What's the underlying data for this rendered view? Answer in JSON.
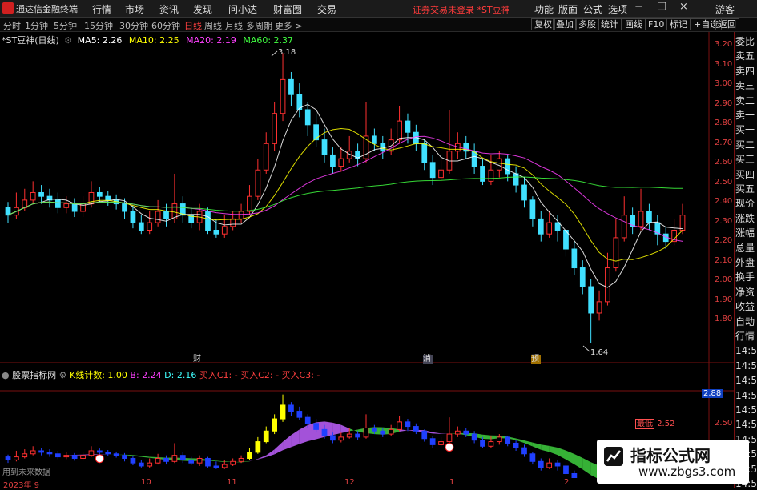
{
  "topbar": {
    "app_name": "通达信金融终端",
    "menus": [
      "行情",
      "市场",
      "资讯",
      "发现",
      "问小达",
      "财富圈",
      "交易"
    ],
    "notice": "证券交易未登录 *ST豆神",
    "right_menus": [
      "功能",
      "版面",
      "公式",
      "选项"
    ],
    "user": "游客"
  },
  "period_bar": {
    "items": [
      "分时",
      "1分钟",
      "5分钟",
      "15分钟",
      "30分钟",
      "60分钟",
      "日线",
      "周线",
      "月线",
      "多周期",
      "更多 >"
    ],
    "active": "日线",
    "tools": [
      "复权",
      "叠加",
      "多股",
      "统计",
      "画线",
      "F10",
      "标记",
      "+自选",
      "返回"
    ]
  },
  "main_legend": {
    "title": "*ST豆神(日线)",
    "ma": [
      {
        "label": "MA5: 2.26",
        "color": "#ffffff"
      },
      {
        "label": "MA10: 2.25",
        "color": "#ffff00"
      },
      {
        "label": "MA20: 2.19",
        "color": "#ff40ff"
      },
      {
        "label": "MA60: 2.37",
        "color": "#40ff40"
      }
    ]
  },
  "ind_legend": {
    "title": "股票指标网",
    "parts": [
      {
        "label": "K线计数: 1.00",
        "color": "#ffff00"
      },
      {
        "label": "B: 2.24",
        "color": "#ff40ff"
      },
      {
        "label": "D: 2.16",
        "color": "#40ffff"
      },
      {
        "label": "买入C1: -",
        "color": "#ff4040"
      },
      {
        "label": "买入C2: -",
        "color": "#ff4040"
      },
      {
        "label": "买入C3: -",
        "color": "#ff4040"
      }
    ]
  },
  "right_panel": [
    "委比",
    "卖五",
    "卖四",
    "卖三",
    "卖二",
    "卖一",
    "买一",
    "买二",
    "买三",
    "买四",
    "买五",
    "现价",
    "涨跌",
    "涨幅",
    "总量",
    "外盘",
    "换手",
    "净资",
    "收益",
    "自动",
    "行情",
    "14:5",
    "14:5",
    "14:5",
    "14:5",
    "14:5",
    "14:5",
    "14:5",
    "14:5",
    "14:5",
    "14:5"
  ],
  "y_axis": [
    "3.20",
    "3.10",
    "3.00",
    "2.90",
    "2.80",
    "2.70",
    "2.60",
    "2.50",
    "2.40",
    "2.30",
    "2.20",
    "2.10",
    "2.00",
    "1.90",
    "1.80"
  ],
  "ind_axis": [
    "2.88",
    "2.50"
  ],
  "x_axis": [
    "2023年 9",
    "10",
    "11",
    "12",
    "1",
    "2"
  ],
  "annotations": {
    "high": "3.18",
    "low": "1.64",
    "ind_tag": "2.52",
    "ind_tag_box": "最低"
  },
  "markers": [
    "财",
    "消",
    "预"
  ],
  "footer_note": "用到未来数据",
  "watermark": {
    "title": "指标公式网",
    "url": "www.zbgs3.com"
  },
  "colors": {
    "up": "#ff3030",
    "down": "#40e0ff",
    "ma5": "#ffffff",
    "ma10": "#ffff00",
    "ma20": "#ff40ff",
    "ma60": "#40ff40"
  },
  "chart_data": {
    "type": "candlestick",
    "ylim": [
      1.6,
      3.25
    ],
    "candles": [
      [
        2.36,
        2.32,
        2.39,
        2.28
      ],
      [
        2.32,
        2.36,
        2.44,
        2.3
      ],
      [
        2.36,
        2.4,
        2.46,
        2.34
      ],
      [
        2.4,
        2.44,
        2.5,
        2.38
      ],
      [
        2.44,
        2.42,
        2.48,
        2.38
      ],
      [
        2.42,
        2.4,
        2.46,
        2.36
      ],
      [
        2.4,
        2.36,
        2.44,
        2.33
      ],
      [
        2.36,
        2.38,
        2.42,
        2.33
      ],
      [
        2.38,
        2.34,
        2.41,
        2.31
      ],
      [
        2.34,
        2.38,
        2.42,
        2.31
      ],
      [
        2.38,
        2.44,
        2.5,
        2.36
      ],
      [
        2.44,
        2.42,
        2.47,
        2.39
      ],
      [
        2.42,
        2.4,
        2.45,
        2.37
      ],
      [
        2.4,
        2.38,
        2.43,
        2.35
      ],
      [
        2.38,
        2.34,
        2.41,
        2.3
      ],
      [
        2.34,
        2.28,
        2.37,
        2.25
      ],
      [
        2.28,
        2.24,
        2.32,
        2.22
      ],
      [
        2.24,
        2.28,
        2.34,
        2.22
      ],
      [
        2.28,
        2.34,
        2.4,
        2.26
      ],
      [
        2.34,
        2.3,
        2.38,
        2.26
      ],
      [
        2.3,
        2.38,
        2.54,
        2.28
      ],
      [
        2.38,
        2.32,
        2.42,
        2.28
      ],
      [
        2.32,
        2.28,
        2.36,
        2.25
      ],
      [
        2.28,
        2.34,
        2.38,
        2.24
      ],
      [
        2.34,
        2.24,
        2.36,
        2.22
      ],
      [
        2.24,
        2.22,
        2.3,
        2.2
      ],
      [
        2.22,
        2.26,
        2.32,
        2.2
      ],
      [
        2.26,
        2.3,
        2.34,
        2.24
      ],
      [
        2.3,
        2.34,
        2.38,
        2.28
      ],
      [
        2.34,
        2.42,
        2.48,
        2.32
      ],
      [
        2.42,
        2.56,
        2.62,
        2.4
      ],
      [
        2.56,
        2.7,
        2.76,
        2.54
      ],
      [
        2.7,
        2.86,
        2.92,
        2.66
      ],
      [
        2.86,
        3.04,
        3.18,
        2.82
      ],
      [
        3.04,
        2.96,
        3.08,
        2.9
      ],
      [
        2.96,
        2.88,
        3.02,
        2.84
      ],
      [
        2.88,
        2.8,
        2.92,
        2.74
      ],
      [
        2.8,
        2.72,
        2.86,
        2.68
      ],
      [
        2.72,
        2.64,
        2.78,
        2.6
      ],
      [
        2.64,
        2.58,
        2.68,
        2.54
      ],
      [
        2.58,
        2.62,
        2.68,
        2.55
      ],
      [
        2.62,
        2.66,
        2.74,
        2.6
      ],
      [
        2.66,
        2.62,
        2.7,
        2.58
      ],
      [
        2.62,
        2.74,
        2.92,
        2.6
      ],
      [
        2.74,
        2.7,
        2.78,
        2.66
      ],
      [
        2.7,
        2.66,
        2.74,
        2.62
      ],
      [
        2.66,
        2.72,
        2.78,
        2.64
      ],
      [
        2.72,
        2.82,
        2.9,
        2.7
      ],
      [
        2.82,
        2.76,
        2.86,
        2.7
      ],
      [
        2.76,
        2.7,
        2.8,
        2.66
      ],
      [
        2.7,
        2.6,
        2.72,
        2.56
      ],
      [
        2.6,
        2.52,
        2.64,
        2.48
      ],
      [
        2.52,
        2.56,
        2.62,
        2.5
      ],
      [
        2.56,
        2.66,
        2.88,
        2.54
      ],
      [
        2.66,
        2.7,
        2.76,
        2.62
      ],
      [
        2.7,
        2.66,
        2.74,
        2.62
      ],
      [
        2.66,
        2.58,
        2.7,
        2.54
      ],
      [
        2.58,
        2.5,
        2.62,
        2.48
      ],
      [
        2.5,
        2.56,
        2.64,
        2.48
      ],
      [
        2.56,
        2.62,
        2.66,
        2.52
      ],
      [
        2.62,
        2.54,
        2.64,
        2.5
      ],
      [
        2.54,
        2.48,
        2.58,
        2.44
      ],
      [
        2.48,
        2.4,
        2.52,
        2.36
      ],
      [
        2.4,
        2.3,
        2.42,
        2.26
      ],
      [
        2.3,
        2.22,
        2.34,
        2.18
      ],
      [
        2.22,
        2.28,
        2.34,
        2.2
      ],
      [
        2.28,
        2.24,
        2.32,
        2.18
      ],
      [
        2.24,
        2.14,
        2.26,
        2.1
      ],
      [
        2.14,
        2.04,
        2.18,
        2.0
      ],
      [
        2.04,
        1.94,
        2.08,
        1.9
      ],
      [
        1.94,
        1.8,
        1.98,
        1.64
      ],
      [
        1.8,
        1.86,
        1.92,
        1.76
      ],
      [
        1.86,
        2.04,
        2.12,
        1.84
      ],
      [
        2.04,
        2.2,
        2.3,
        2.02
      ],
      [
        2.2,
        2.32,
        2.42,
        2.18
      ],
      [
        2.32,
        2.26,
        2.36,
        2.22
      ],
      [
        2.26,
        2.34,
        2.46,
        2.24
      ],
      [
        2.34,
        2.28,
        2.38,
        2.24
      ],
      [
        2.28,
        2.22,
        2.32,
        2.16
      ],
      [
        2.22,
        2.18,
        2.26,
        2.14
      ],
      [
        2.18,
        2.24,
        2.3,
        2.16
      ],
      [
        2.24,
        2.32,
        2.38,
        2.22
      ]
    ]
  }
}
